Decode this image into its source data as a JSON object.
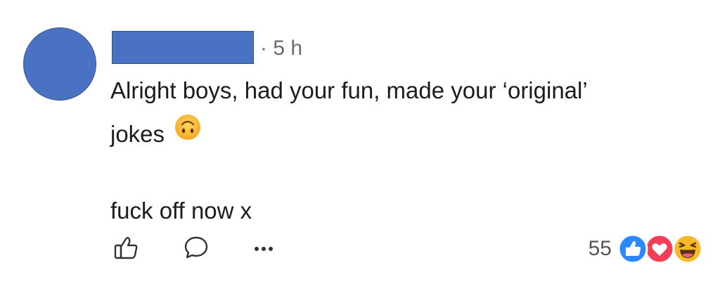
{
  "comment": {
    "author_redacted": "",
    "time": "· 5 h",
    "lines": [
      "Alright boys, had your fun, made your ‘original’",
      "jokes",
      "fuck off now x"
    ],
    "emoji_after_line_2": "upside-down-face-emoji"
  },
  "actions": {
    "like_icon": "thumbs-up-outline-icon",
    "reply_icon": "comment-bubble-icon",
    "more_icon": "more-dots-icon"
  },
  "reactions": {
    "count": "55",
    "icons": [
      "like-reaction-icon",
      "love-reaction-icon",
      "haha-reaction-icon"
    ],
    "colors": {
      "like": "#2d88ff",
      "love": "#f33e58",
      "haha": "#f7b928"
    }
  },
  "colors": {
    "redaction_blue": "#4a72c2",
    "text": "#1c1c1e",
    "muted": "#6b6b6b"
  }
}
